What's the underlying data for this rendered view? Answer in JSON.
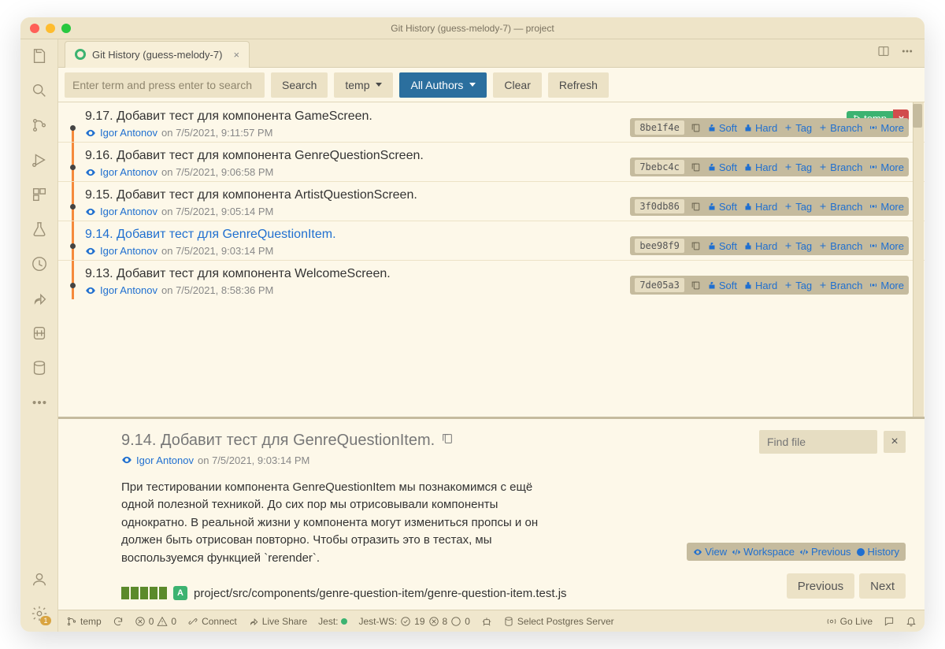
{
  "title": "Git History (guess-melody-7) — project",
  "tab": {
    "label": "Git History (guess-melody-7)"
  },
  "filter": {
    "placeholder": "Enter term and press enter to search",
    "search": "Search",
    "branch": "temp",
    "authors": "All Authors",
    "clear": "Clear",
    "refresh": "Refresh"
  },
  "tag": {
    "name": "temp",
    "close": "×"
  },
  "actions": {
    "soft": "Soft",
    "hard": "Hard",
    "tag": "Tag",
    "branch": "Branch",
    "more": "More"
  },
  "commits": [
    {
      "title": "9.17. Добавит тест для компонента GameScreen.",
      "author": "Igor Antonov",
      "date": "on 7/5/2021, 9:11:57 PM",
      "hash": "8be1f4e",
      "first": true,
      "selected": false
    },
    {
      "title": "9.16. Добавит тест для компонента GenreQuestionScreen.",
      "author": "Igor Antonov",
      "date": "on 7/5/2021, 9:06:58 PM",
      "hash": "7bebc4c",
      "first": false,
      "selected": false
    },
    {
      "title": "9.15. Добавит тест для компонента ArtistQuestionScreen.",
      "author": "Igor Antonov",
      "date": "on 7/5/2021, 9:05:14 PM",
      "hash": "3f0db86",
      "first": false,
      "selected": false
    },
    {
      "title": "9.14. Добавит тест для GenreQuestionItem.",
      "author": "Igor Antonov",
      "date": "on 7/5/2021, 9:03:14 PM",
      "hash": "bee98f9",
      "first": false,
      "selected": true
    },
    {
      "title": "9.13. Добавит тест для компонента WelcomeScreen.",
      "author": "Igor Antonov",
      "date": "on 7/5/2021, 8:58:36 PM",
      "hash": "7de05a3",
      "first": false,
      "selected": false
    }
  ],
  "detail": {
    "title": "9.14. Добавит тест для GenreQuestionItem.",
    "author": "Igor Antonov",
    "date": "on 7/5/2021, 9:03:14 PM",
    "body": "При тестировании компонента GenreQuestionItem мы познакомимся с ещё одной полезной техникой. До сих пор мы отрисовывали компоненты однократно. В реальной жизни у компонента могут измениться пропсы и он должен быть отрисован повторно. Чтобы отразить это в тестах, мы воспользуемся функцией `rerender`.",
    "find_placeholder": "Find file",
    "file": {
      "badge": "A",
      "path": "project/src/components/genre-question-item/genre-question-item.test.js"
    },
    "file_actions": {
      "view": "View",
      "workspace": "Workspace",
      "previous": "Previous",
      "history": "History"
    },
    "pager": {
      "prev": "Previous",
      "next": "Next"
    }
  },
  "statusbar": {
    "branch": "temp",
    "errors": "0",
    "warnings": "0",
    "connect": "Connect",
    "liveshare": "Live Share",
    "jest_label": "Jest:",
    "jestws": "Jest-WS:",
    "jest_pass": "19",
    "jest_fail": "8",
    "jest_skip": "0",
    "postgres": "Select Postgres Server",
    "golive": "Go Live",
    "badge_count": "1"
  }
}
